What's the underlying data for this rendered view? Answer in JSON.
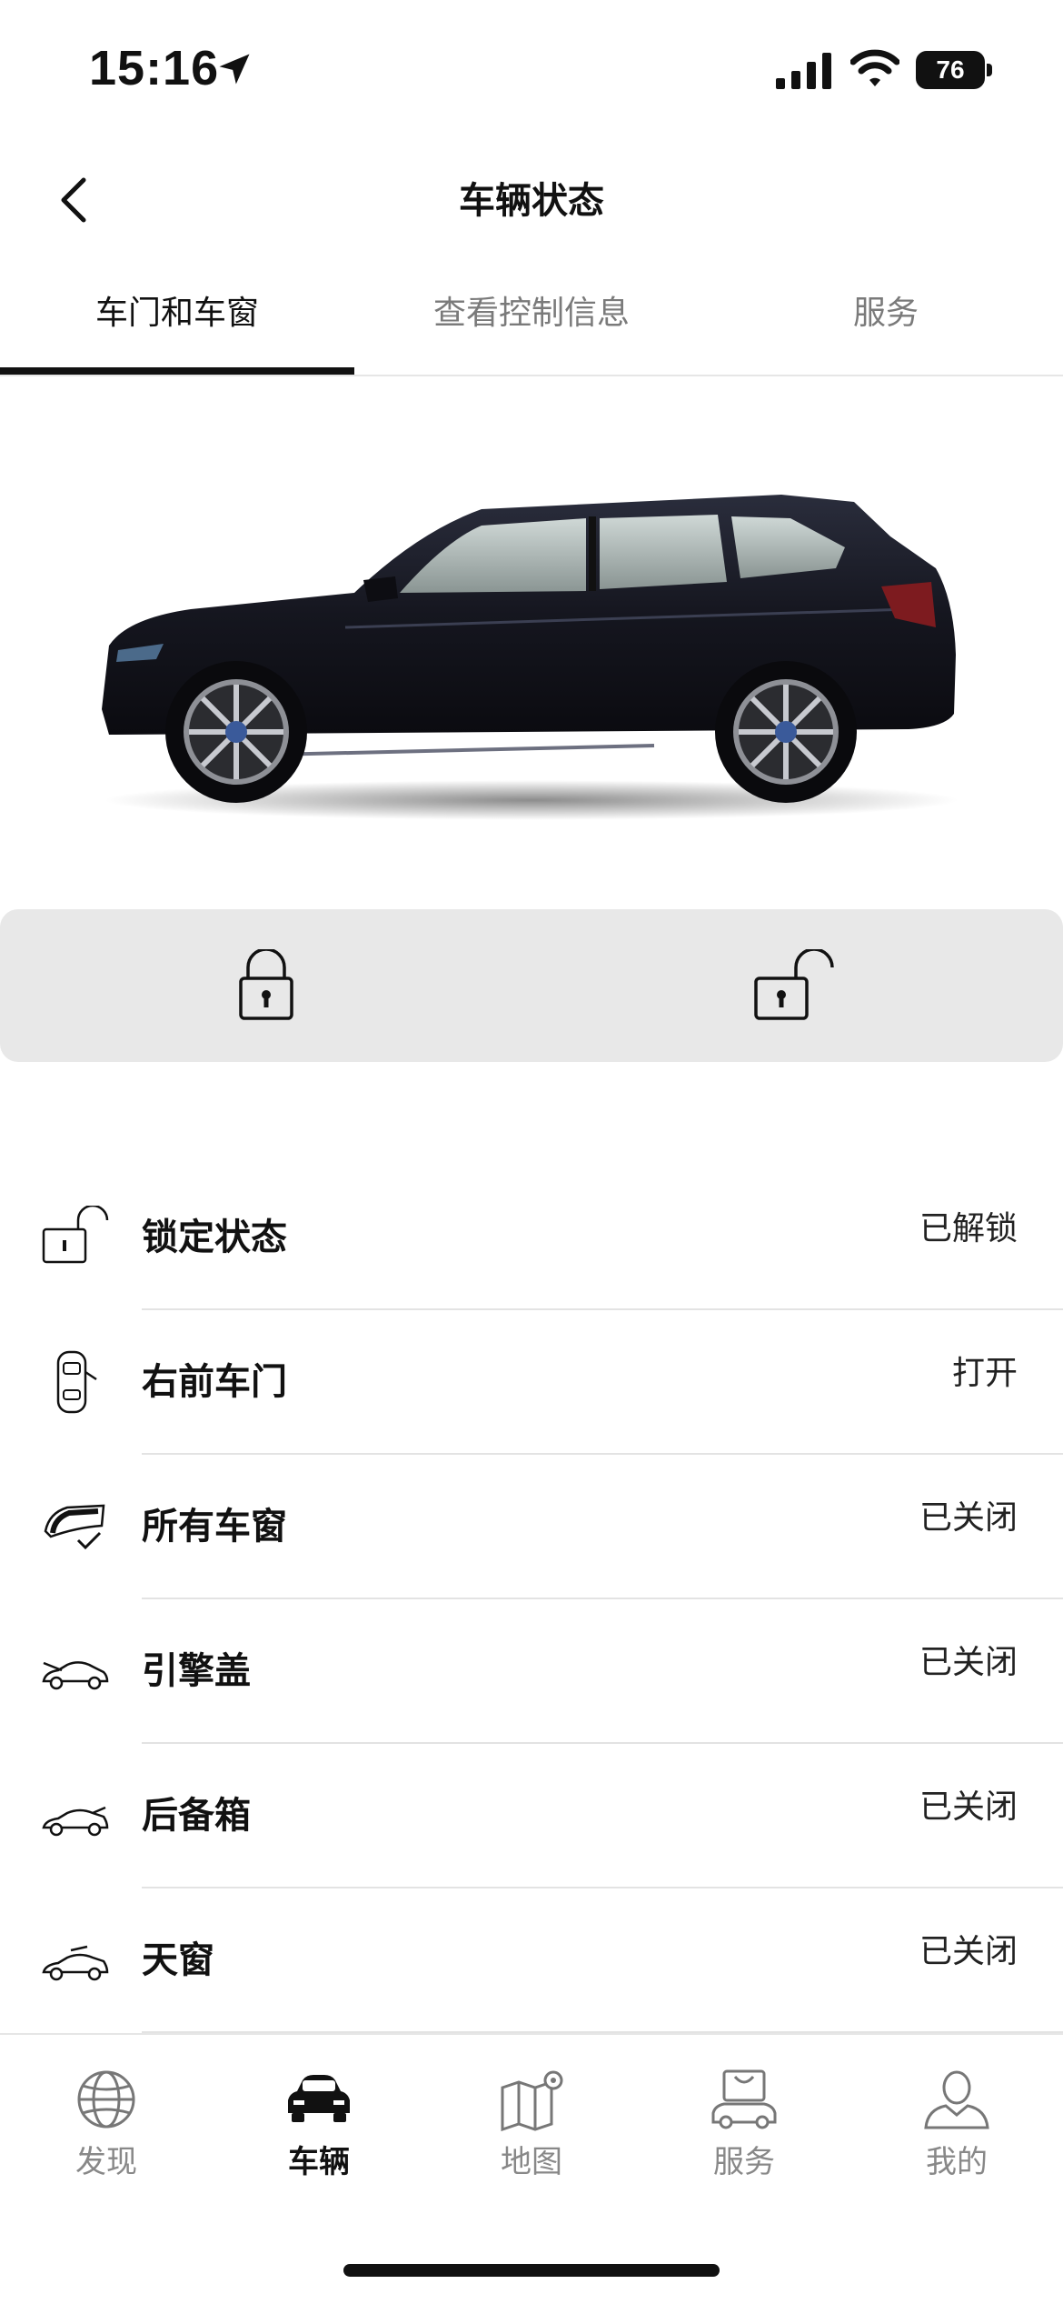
{
  "status_bar": {
    "time": "15:16",
    "battery": "76"
  },
  "nav": {
    "title": "车辆状态"
  },
  "tabs": [
    {
      "label": "车门和车窗",
      "active": true
    },
    {
      "label": "查看控制信息",
      "active": false
    },
    {
      "label": "服务",
      "active": false
    }
  ],
  "status_list": [
    {
      "label": "锁定状态",
      "value": "已解锁",
      "icon": "unlocked-padlock-icon"
    },
    {
      "label": "右前车门",
      "value": "打开",
      "icon": "car-door-open-icon"
    },
    {
      "label": "所有车窗",
      "value": "已关闭",
      "icon": "window-check-icon"
    },
    {
      "label": "引擎盖",
      "value": "已关闭",
      "icon": "car-hood-icon"
    },
    {
      "label": "后备箱",
      "value": "已关闭",
      "icon": "car-trunk-icon"
    },
    {
      "label": "天窗",
      "value": "已关闭",
      "icon": "car-sunroof-icon"
    }
  ],
  "tabbar": [
    {
      "label": "发现",
      "icon": "globe-icon",
      "active": false
    },
    {
      "label": "车辆",
      "icon": "car-icon",
      "active": true
    },
    {
      "label": "地图",
      "icon": "map-icon",
      "active": false
    },
    {
      "label": "服务",
      "icon": "service-bag-icon",
      "active": false
    },
    {
      "label": "我的",
      "icon": "person-icon",
      "active": false
    }
  ]
}
